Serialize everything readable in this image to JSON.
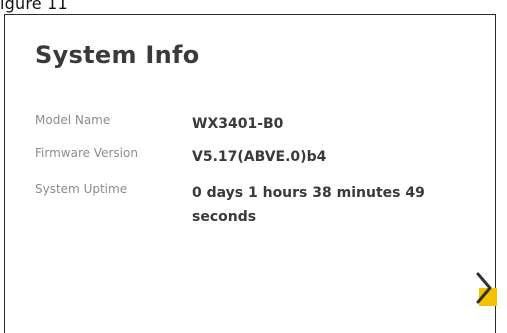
{
  "caption": "igure 11",
  "card": {
    "title": "System Info",
    "rows": [
      {
        "label": "Model Name",
        "value": "WX3401-B0"
      },
      {
        "label": "Firmware Version",
        "value": "V5.17(ABVE.0)b4"
      },
      {
        "label": "System Uptime",
        "value": "0 days 1 hours 38 minutes 49 seconds"
      }
    ]
  },
  "colors": {
    "accent": "#f2c200",
    "title_text": "#3a3a3a",
    "label_text": "#8c8c8c",
    "border": "#2b2b2b"
  },
  "icons": {
    "next": "chevron-right-icon"
  }
}
